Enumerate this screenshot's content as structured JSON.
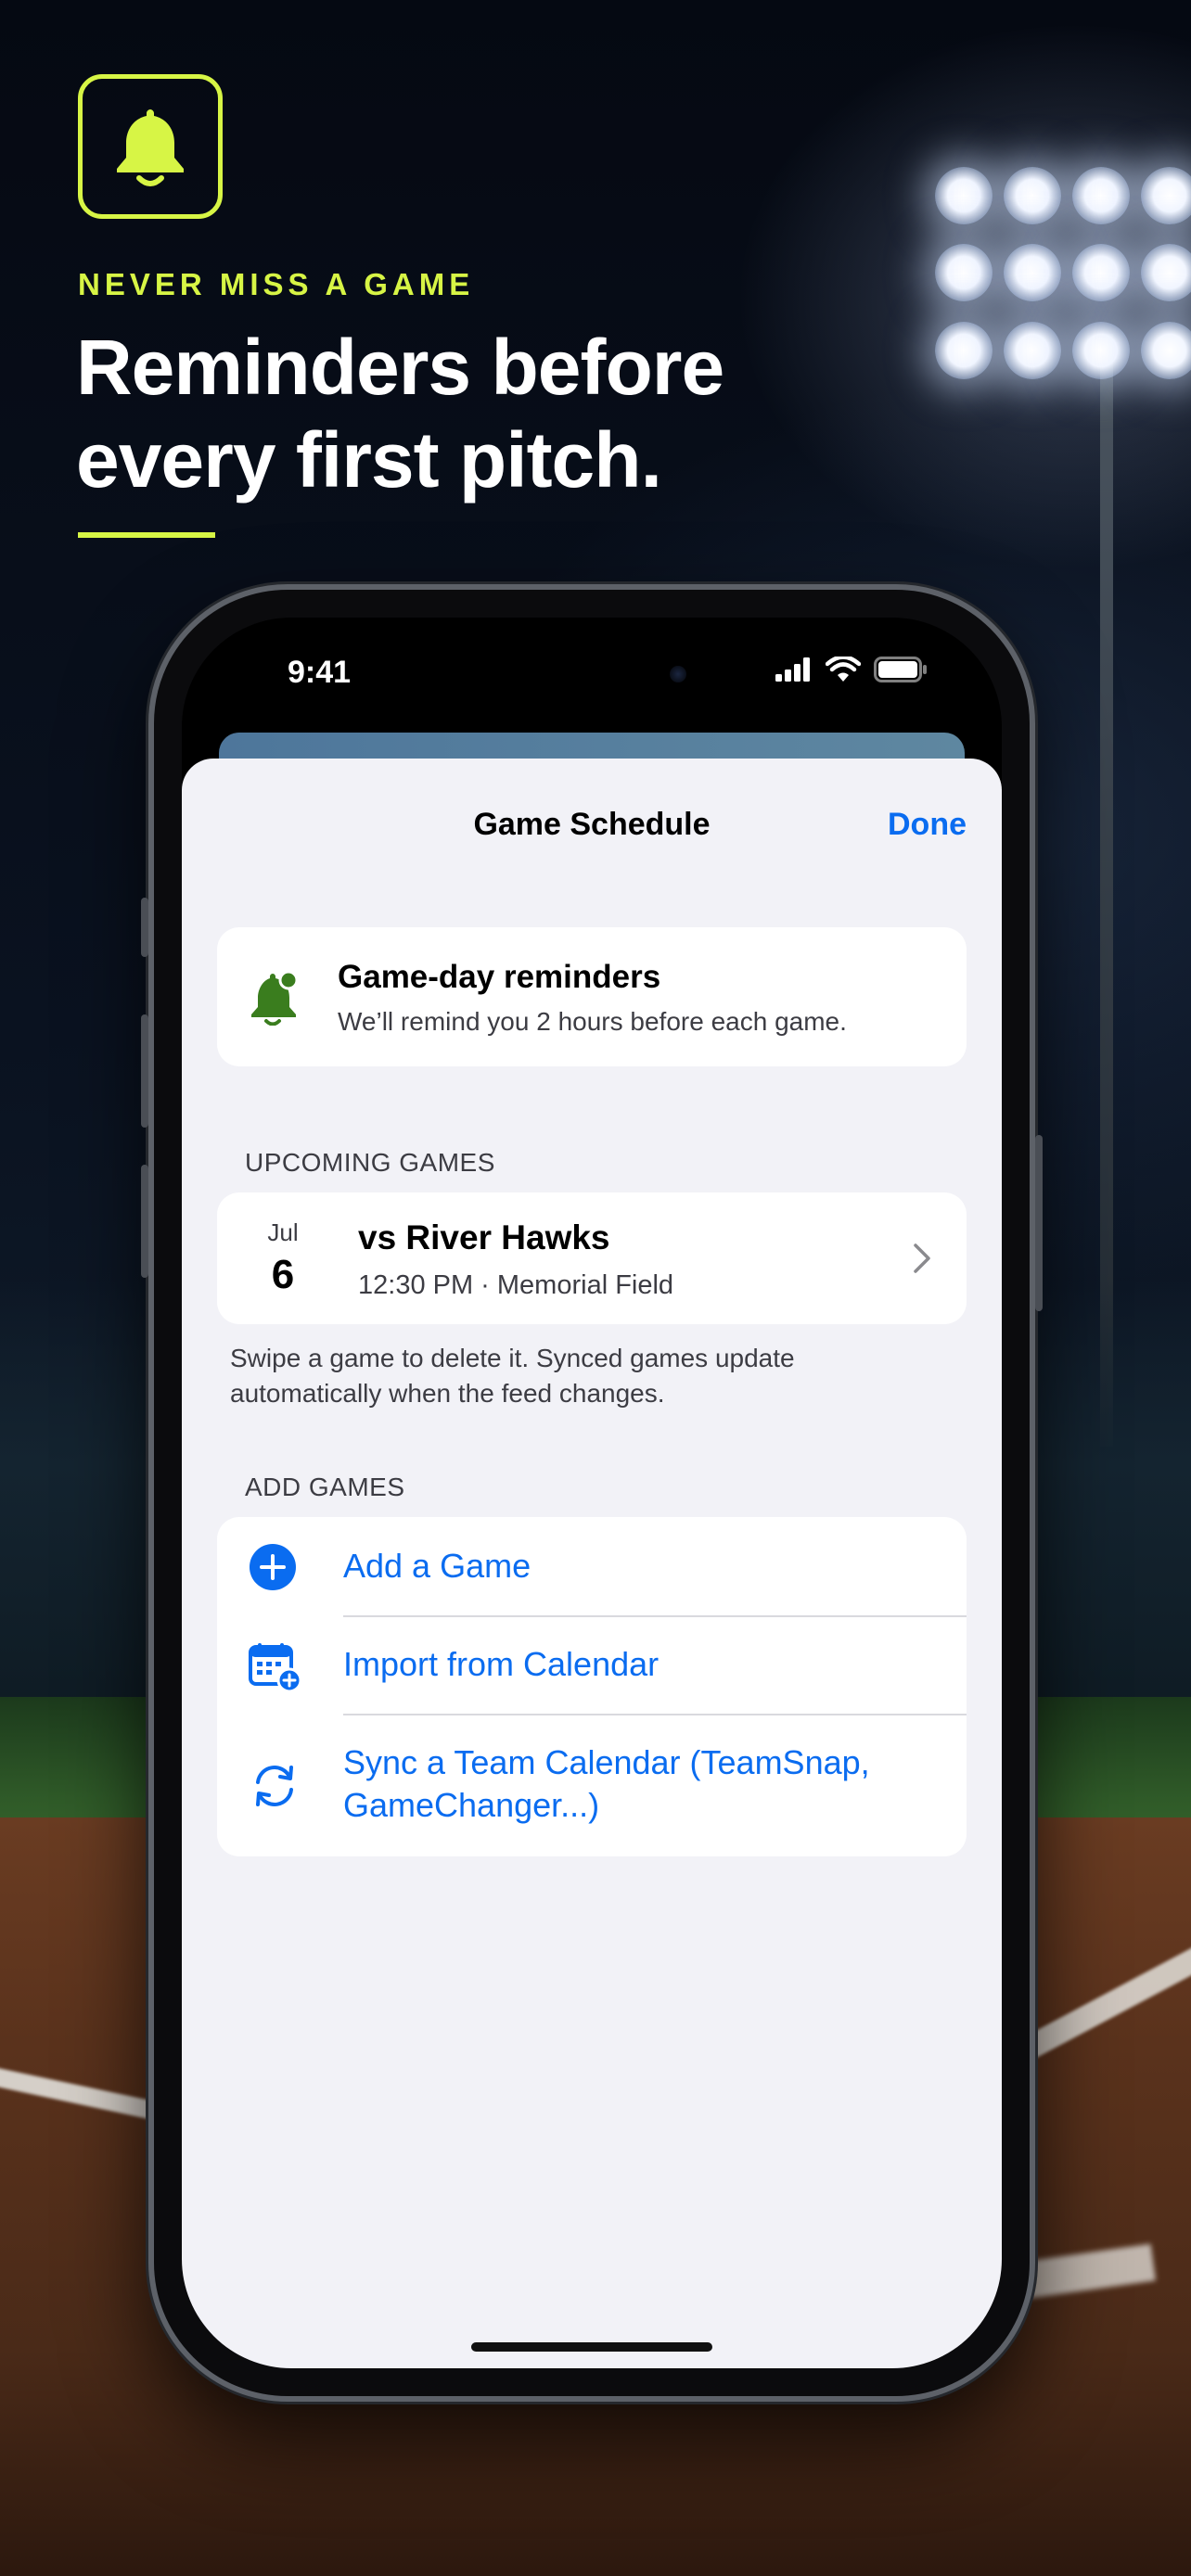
{
  "hero": {
    "eyebrow": "NEVER MISS A GAME",
    "headline_line1": "Reminders before",
    "headline_line2": "every first pitch.",
    "icon": "bell-icon",
    "accent_color": "#d7f545"
  },
  "status_bar": {
    "time": "9:41",
    "icons": [
      "cellular-signal-icon",
      "wifi-icon",
      "battery-icon"
    ]
  },
  "sheet": {
    "title": "Game Schedule",
    "done_label": "Done",
    "accent_color": "#0a6cf0"
  },
  "reminder": {
    "icon": "bell-badge-icon",
    "title": "Game-day reminders",
    "subtitle": "We’ll remind you 2 hours before each game.",
    "icon_color": "#3a7d1e"
  },
  "upcoming": {
    "header": "UPCOMING GAMES",
    "games": [
      {
        "month": "Jul",
        "day": "6",
        "title": "vs River Hawks",
        "details": "12:30 PM · Memorial Field"
      }
    ],
    "footnote": "Swipe a game to delete it. Synced games update automatically when the feed changes."
  },
  "add_games": {
    "header": "ADD GAMES",
    "items": [
      {
        "icon": "plus-circle-icon",
        "label": "Add a Game"
      },
      {
        "icon": "calendar-add-icon",
        "label": "Import from Calendar"
      },
      {
        "icon": "sync-icon",
        "label": "Sync a Team Calendar (TeamSnap, GameChanger...)"
      }
    ]
  }
}
